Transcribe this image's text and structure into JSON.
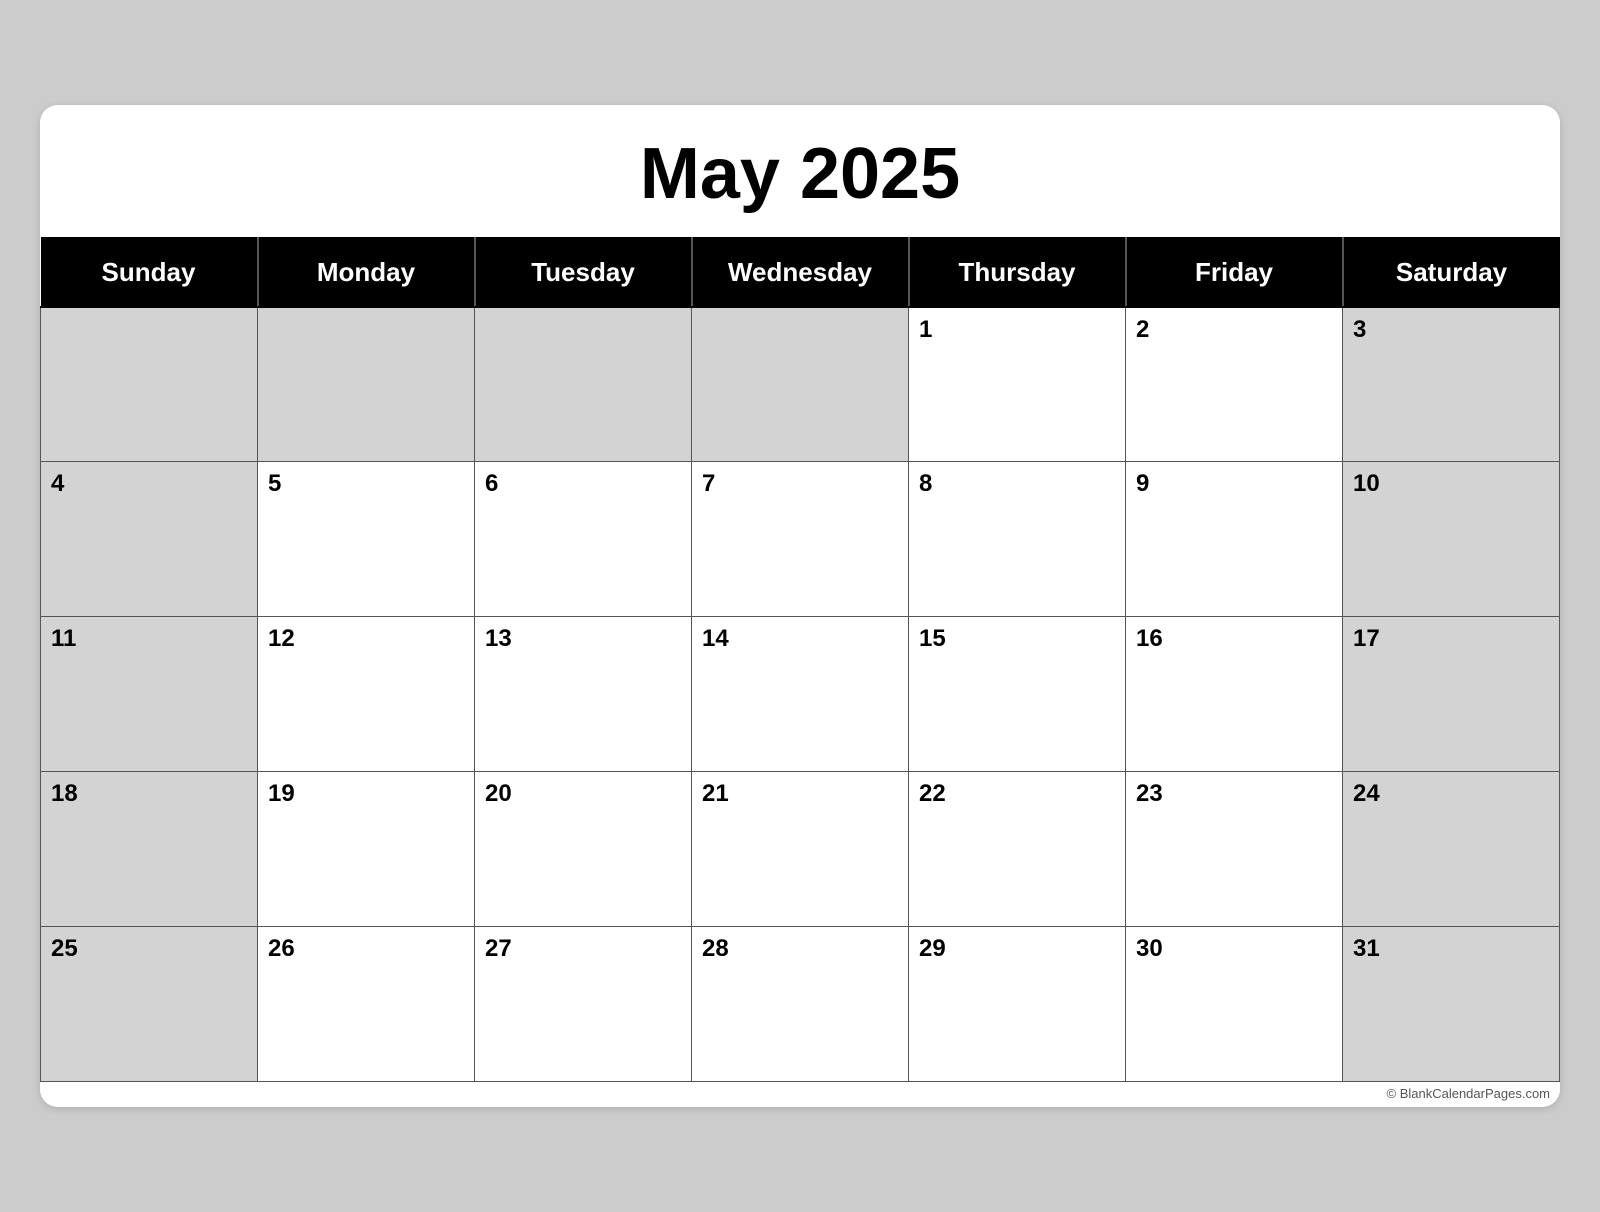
{
  "title": "May 2025",
  "days_of_week": [
    "Sunday",
    "Monday",
    "Tuesday",
    "Wednesday",
    "Thursday",
    "Friday",
    "Saturday"
  ],
  "weeks": [
    [
      {
        "date": "",
        "type": "empty"
      },
      {
        "date": "",
        "type": "empty"
      },
      {
        "date": "",
        "type": "empty"
      },
      {
        "date": "",
        "type": "empty"
      },
      {
        "date": "1",
        "type": "normal"
      },
      {
        "date": "2",
        "type": "normal"
      },
      {
        "date": "3",
        "type": "weekend-saturday"
      }
    ],
    [
      {
        "date": "4",
        "type": "weekend-sunday"
      },
      {
        "date": "5",
        "type": "normal"
      },
      {
        "date": "6",
        "type": "normal"
      },
      {
        "date": "7",
        "type": "normal"
      },
      {
        "date": "8",
        "type": "normal"
      },
      {
        "date": "9",
        "type": "normal"
      },
      {
        "date": "10",
        "type": "weekend-saturday"
      }
    ],
    [
      {
        "date": "11",
        "type": "weekend-sunday"
      },
      {
        "date": "12",
        "type": "normal"
      },
      {
        "date": "13",
        "type": "normal"
      },
      {
        "date": "14",
        "type": "normal"
      },
      {
        "date": "15",
        "type": "normal"
      },
      {
        "date": "16",
        "type": "normal"
      },
      {
        "date": "17",
        "type": "weekend-saturday"
      }
    ],
    [
      {
        "date": "18",
        "type": "weekend-sunday"
      },
      {
        "date": "19",
        "type": "normal"
      },
      {
        "date": "20",
        "type": "normal"
      },
      {
        "date": "21",
        "type": "normal"
      },
      {
        "date": "22",
        "type": "normal"
      },
      {
        "date": "23",
        "type": "normal"
      },
      {
        "date": "24",
        "type": "weekend-saturday"
      }
    ],
    [
      {
        "date": "25",
        "type": "weekend-sunday"
      },
      {
        "date": "26",
        "type": "normal"
      },
      {
        "date": "27",
        "type": "normal"
      },
      {
        "date": "28",
        "type": "normal"
      },
      {
        "date": "29",
        "type": "normal"
      },
      {
        "date": "30",
        "type": "normal"
      },
      {
        "date": "31",
        "type": "weekend-saturday"
      }
    ]
  ],
  "watermark": "© BlankCalendarPages.com"
}
